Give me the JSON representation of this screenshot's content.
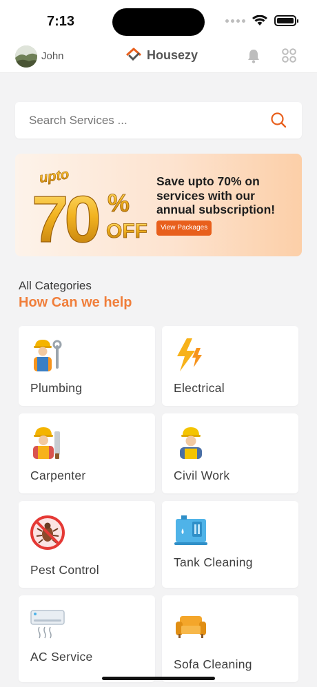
{
  "status_bar": {
    "time": "7:13"
  },
  "header": {
    "user_name": "John",
    "brand": "Housezy"
  },
  "search": {
    "placeholder": "Search Services ..."
  },
  "banner": {
    "headline_line1": "Save upto 70% on",
    "headline_line2": "services with our",
    "headline_line3": "annual subscription!",
    "button_label": "View Packages",
    "graphic_top": "upto",
    "graphic_number": "70",
    "graphic_percent": "%",
    "graphic_off": "OFF"
  },
  "categories": {
    "subtitle": "All Categories",
    "title": "How Can we help",
    "items": [
      {
        "label": "Plumbing",
        "icon": "plumber-icon"
      },
      {
        "label": "Electrical",
        "icon": "lightning-icon"
      },
      {
        "label": "Carpenter",
        "icon": "carpenter-icon"
      },
      {
        "label": "Civil Work",
        "icon": "construction-worker-icon"
      },
      {
        "label": "Pest Control",
        "icon": "pest-control-icon"
      },
      {
        "label": "Tank Cleaning",
        "icon": "water-tank-icon"
      },
      {
        "label": "AC Service",
        "icon": "air-conditioner-icon"
      },
      {
        "label": "Sofa Cleaning",
        "icon": "sofa-icon"
      }
    ]
  },
  "colors": {
    "accent": "#f07e3a",
    "button": "#e85f1c",
    "background": "#f3f3f4"
  }
}
